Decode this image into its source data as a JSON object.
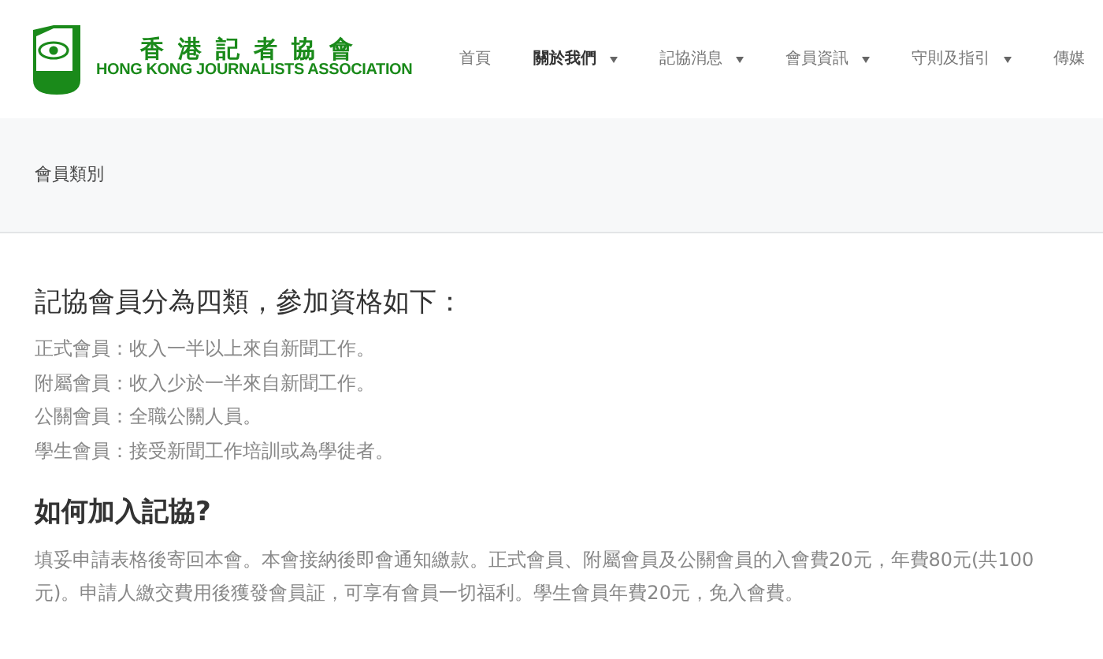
{
  "logo": {
    "title": "香港記者協會",
    "subtitle": "HONG KONG JOURNALISTS ASSOCIATION"
  },
  "nav": [
    {
      "label": "首頁",
      "selected": false,
      "dropdown": false
    },
    {
      "label": "關於我們",
      "selected": true,
      "dropdown": true
    },
    {
      "label": "記協消息",
      "selected": false,
      "dropdown": true
    },
    {
      "label": "會員資訊",
      "selected": false,
      "dropdown": true
    },
    {
      "label": "守則及指引",
      "selected": false,
      "dropdown": true
    },
    {
      "label": "傳媒",
      "selected": false,
      "dropdown": false
    }
  ],
  "breadcrumb": "會員類別",
  "sections": [
    {
      "heading": "記協會員分為四類，參加資格如下：",
      "lines": [
        "正式會員：收入一半以上來自新聞工作。",
        "附屬會員：收入少於一半來自新聞工作。",
        "公關會員：全職公關人員。",
        "學生會員：接受新聞工作培訓或為學徒者。"
      ]
    },
    {
      "heading": "如何加入記協?",
      "lines": [
        "填妥申請表格後寄回本會。本會接納後即會通知繳款。正式會員、附屬會員及公關會員的入會費20元，年費80元(共100元)。申請人繳交費用後獲發會員証，可享有會員一切福利。學生會員年費20元，免入會費。"
      ]
    }
  ]
}
